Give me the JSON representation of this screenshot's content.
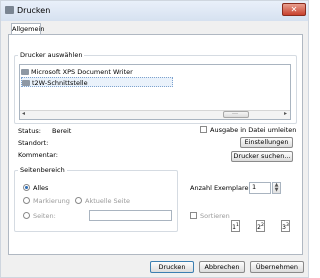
{
  "window": {
    "title": "Drucken",
    "close_glyph": "✕"
  },
  "tabs": [
    {
      "label": "Allgemein"
    }
  ],
  "printer_select": {
    "legend": "Drucker auswählen",
    "printers": [
      {
        "label": "Microsoft XPS Document Writer",
        "icon": "printer-icon",
        "selected": false
      },
      {
        "label": "t2W-Schnittstelle",
        "icon": "printer-icon",
        "selected": true
      }
    ],
    "scroll_left": "◂",
    "scroll_right": "▸",
    "scroll_grip": "…"
  },
  "status": {
    "status_label": "Status:",
    "status_value": "Bereit",
    "location_label": "Standort:",
    "comment_label": "Kommentar:",
    "print_to_file_label": "Ausgabe in Datei umleiten",
    "print_to_file_checked": false,
    "preferences_button": "Einstellungen",
    "find_printer_button": "Drucker suchen..."
  },
  "page_range": {
    "legend": "Seitenbereich",
    "all_label": "Alles",
    "selection_label": "Markierung",
    "current_page_label": "Aktuelle Seite",
    "pages_label": "Seiten:",
    "pages_value": "",
    "selected": "all"
  },
  "copies": {
    "count_label": "Anzahl Exemplare:",
    "count_value": "1",
    "collate_label": "Sortieren",
    "collate_checked": false,
    "pages_preview": [
      {
        "n": "1",
        "sup": "1"
      },
      {
        "n": "2",
        "sup": "2"
      },
      {
        "n": "3",
        "sup": "3"
      }
    ]
  },
  "footer": {
    "print_button": "Drucken",
    "cancel_button": "Abbrechen",
    "apply_button": "Übernehmen"
  },
  "colors": {
    "accent": "#2b6cb5",
    "selection": "#eaf2fb"
  }
}
